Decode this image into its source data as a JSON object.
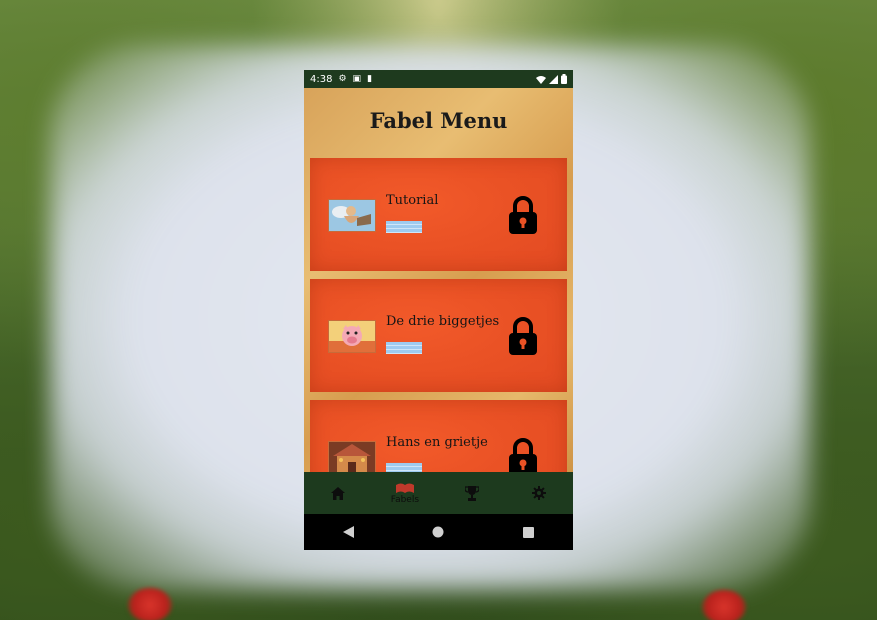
{
  "status_bar": {
    "time": "4:38"
  },
  "app": {
    "title": "Fabel Menu",
    "fables": [
      {
        "title": "Tutorial",
        "locked": true,
        "thumbnail": "cherub-image"
      },
      {
        "title": "De drie biggetjes",
        "locked": true,
        "thumbnail": "pig-image"
      },
      {
        "title": "Hans en grietje",
        "locked": true,
        "thumbnail": "gingerbread-house-image"
      }
    ],
    "bottom_nav": [
      {
        "icon": "home-icon",
        "label": "",
        "active": false
      },
      {
        "icon": "book-icon",
        "label": "Fabels",
        "active": true
      },
      {
        "icon": "trophy-icon",
        "label": "",
        "active": false
      },
      {
        "icon": "gear-icon",
        "label": "",
        "active": false
      }
    ]
  },
  "colors": {
    "status_bar": "#1e3a1e",
    "card": "#ea5225",
    "bottom_nav": "#1d3a1e",
    "active_icon": "#c0392b"
  }
}
